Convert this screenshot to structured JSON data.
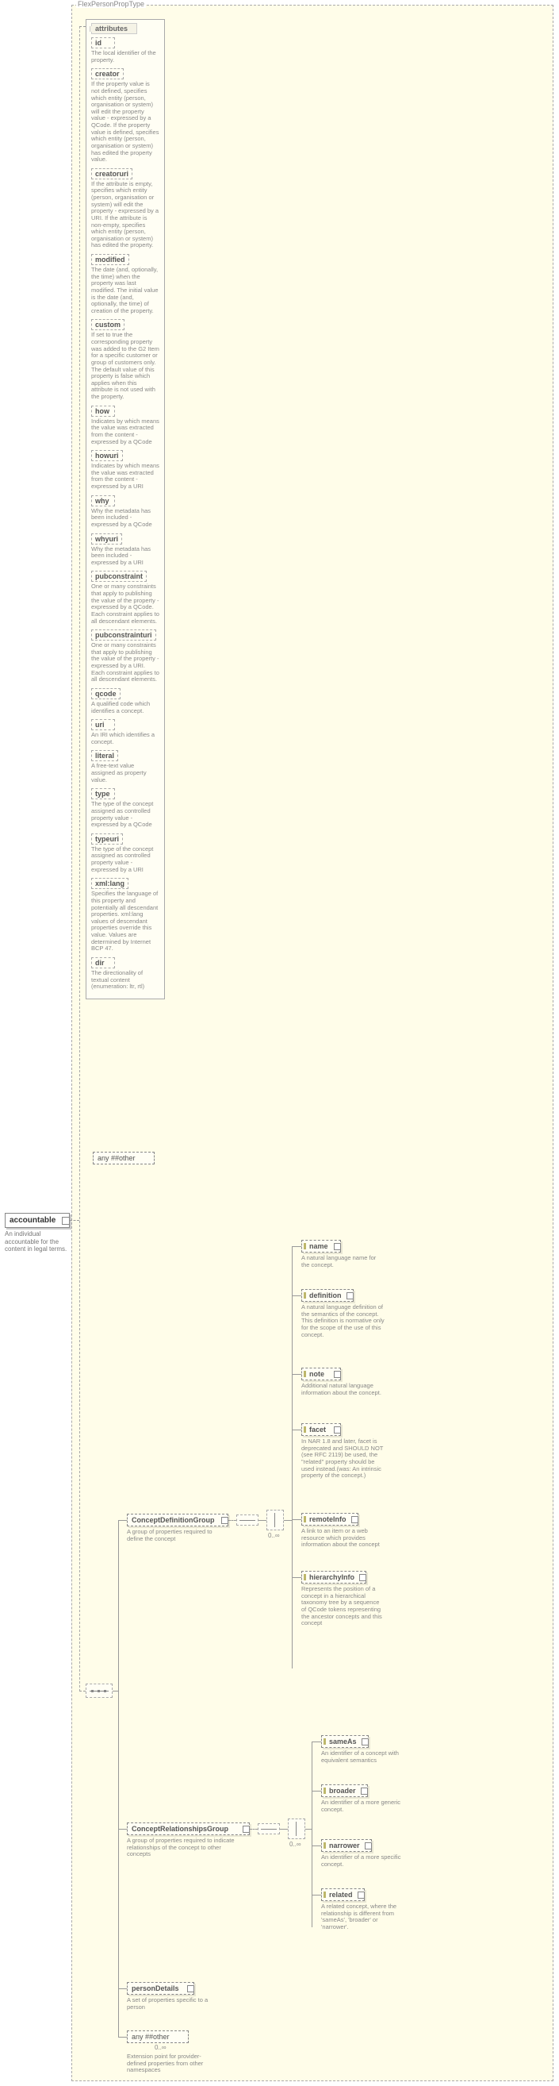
{
  "typeName": "FlexPersonPropType",
  "root": {
    "name": "accountable",
    "desc": "An individual accountable for the content in legal terms."
  },
  "attrHeader": "attributes",
  "attrs": [
    {
      "name": "id",
      "desc": "The local identifier of the property."
    },
    {
      "name": "creator",
      "desc": "If the property value is not defined, specifies which entity (person, organisation or system) will edit the property value - expressed by a QCode. If the property value is defined, specifies which entity (person, organisation or system) has edited the property value."
    },
    {
      "name": "creatoruri",
      "desc": "If the attribute is empty, specifies which entity (person, organisation or system) will edit the property - expressed by a URI. If the attribute is non-empty, specifies which entity (person, organisation or system) has edited the property."
    },
    {
      "name": "modified",
      "desc": "The date (and, optionally, the time) when the property was last modified. The initial value is the date (and, optionally, the time) of creation of the property."
    },
    {
      "name": "custom",
      "desc": "If set to true the corresponding property was added to the G2 Item for a specific customer or group of customers only. The default value of this property is false which applies when this attribute is not used with the property."
    },
    {
      "name": "how",
      "desc": "Indicates by which means the value was extracted from the content - expressed by a QCode"
    },
    {
      "name": "howuri",
      "desc": "Indicates by which means the value was extracted from the content - expressed by a URI"
    },
    {
      "name": "why",
      "desc": "Why the metadata has been included - expressed by a QCode"
    },
    {
      "name": "whyuri",
      "desc": "Why the metadata has been included - expressed by a URI"
    },
    {
      "name": "pubconstraint",
      "desc": "One or many constraints that apply to publishing the value of the property - expressed by a QCode. Each constraint applies to all descendant elements."
    },
    {
      "name": "pubconstrainturi",
      "desc": "One or many constraints that apply to publishing the value of the property - expressed by a URI. Each constraint applies to all descendant elements."
    },
    {
      "name": "qcode",
      "desc": "A qualified code which identifies a concept."
    },
    {
      "name": "uri",
      "desc": "An IRI which identifies a concept."
    },
    {
      "name": "literal",
      "desc": "A free-text value assigned as property value."
    },
    {
      "name": "type",
      "desc": "The type of the concept assigned as controlled property value - expressed by a QCode"
    },
    {
      "name": "typeuri",
      "desc": "The type of the concept assigned as controlled property value - expressed by a URI"
    },
    {
      "name": "xml:lang",
      "desc": "Specifies the language of this property and potentially all descendant properties. xml:lang values of descendant properties override this value. Values are determined by Internet BCP 47."
    },
    {
      "name": "dir",
      "desc": "The directionality of textual content (enumeration: ltr, rtl)"
    }
  ],
  "anyLabel": "any ##other",
  "groups": {
    "cdg": {
      "name": "ConceptDefinitionGroup",
      "desc": "A group of properties required to define the concept"
    },
    "crg": {
      "name": "ConceptRelationshipsGroup",
      "desc": "A group of properties required to indicate relationships of the concept to other concepts"
    }
  },
  "cdg_children": [
    {
      "name": "name",
      "desc": "A natural language name for the concept."
    },
    {
      "name": "definition",
      "desc": "A natural language definition of the semantics of the concept. This definition is normative only for the scope of the use of this concept."
    },
    {
      "name": "note",
      "desc": "Additional natural language information about the concept."
    },
    {
      "name": "facet",
      "desc": "In NAR 1.8 and later, facet is deprecated and SHOULD NOT (see RFC 2119) be used, the \"related\" property should be used instead.(was: An intrinsic property of the concept.)"
    },
    {
      "name": "remoteInfo",
      "desc": "A link to an item or a web resource which provides information about the concept"
    },
    {
      "name": "hierarchyInfo",
      "desc": "Represents the position of a concept in a hierarchical taxonomy tree by a sequence of QCode tokens representing the ancestor concepts and this concept"
    }
  ],
  "crg_children": [
    {
      "name": "sameAs",
      "desc": "An identifier of a concept with equivalent semantics"
    },
    {
      "name": "broader",
      "desc": "An identifier of a more generic concept."
    },
    {
      "name": "narrower",
      "desc": "An identifier of a more specific concept."
    },
    {
      "name": "related",
      "desc": "A related concept, where the relationship is different from 'sameAs', 'broader' or 'narrower'."
    }
  ],
  "personDetails": {
    "name": "personDetails",
    "desc": "A set of properties specific to a person"
  },
  "anyOther": {
    "label": "any ##other",
    "card": "0..∞",
    "desc": "Extension point for provider-defined properties from other namespaces"
  },
  "cdgCard": "0..∞",
  "crgCard": "0..∞"
}
